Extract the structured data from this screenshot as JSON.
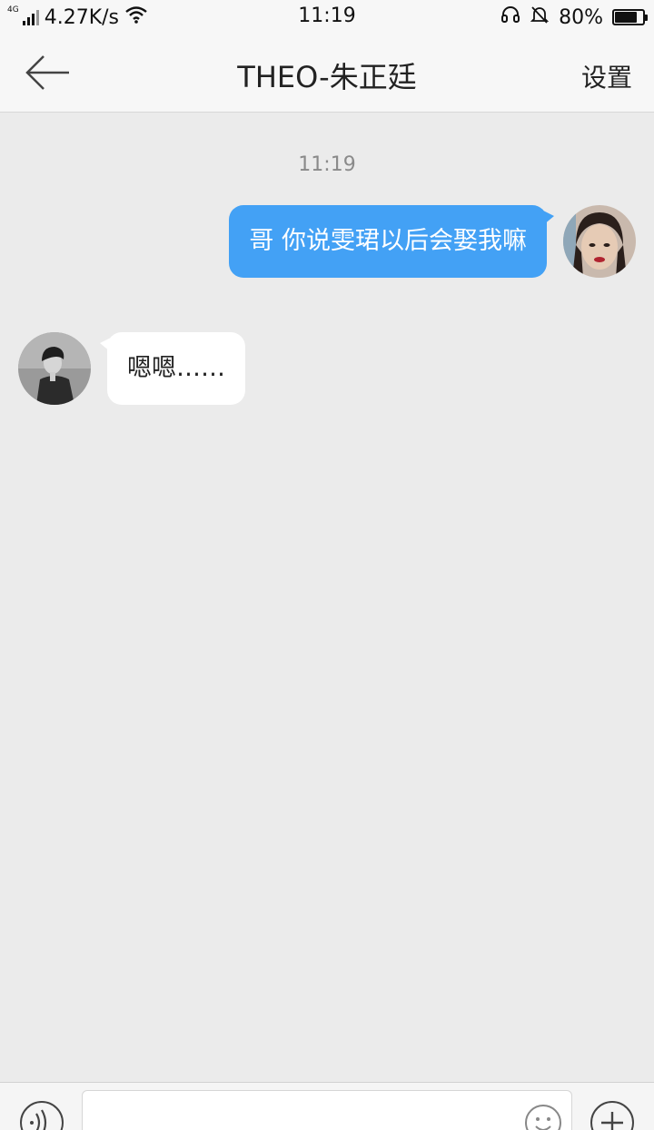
{
  "status_bar": {
    "network": "4G",
    "speed": "4.27K/s",
    "time": "11:19",
    "battery": "80%",
    "battery_level": 0.8,
    "icons": [
      "signal-icon",
      "wifi-icon",
      "headset-icon",
      "mute-bell-icon",
      "battery-icon"
    ]
  },
  "header": {
    "title": "THEO-朱正廷",
    "settings_label": "设置",
    "back_icon": "back-arrow-icon"
  },
  "chat": {
    "timestamp": "11:19",
    "messages": [
      {
        "direction": "outgoing",
        "text": "哥 你说雯珺以后会娶我嘛"
      },
      {
        "direction": "incoming",
        "text": "嗯嗯……"
      }
    ]
  },
  "input_bar": {
    "value": "",
    "icons": [
      "voice-icon",
      "emoji-icon",
      "plus-icon"
    ]
  },
  "colors": {
    "outgoing_bubble": "#43a1f5",
    "incoming_bubble": "#ffffff",
    "background": "#ebebeb"
  }
}
